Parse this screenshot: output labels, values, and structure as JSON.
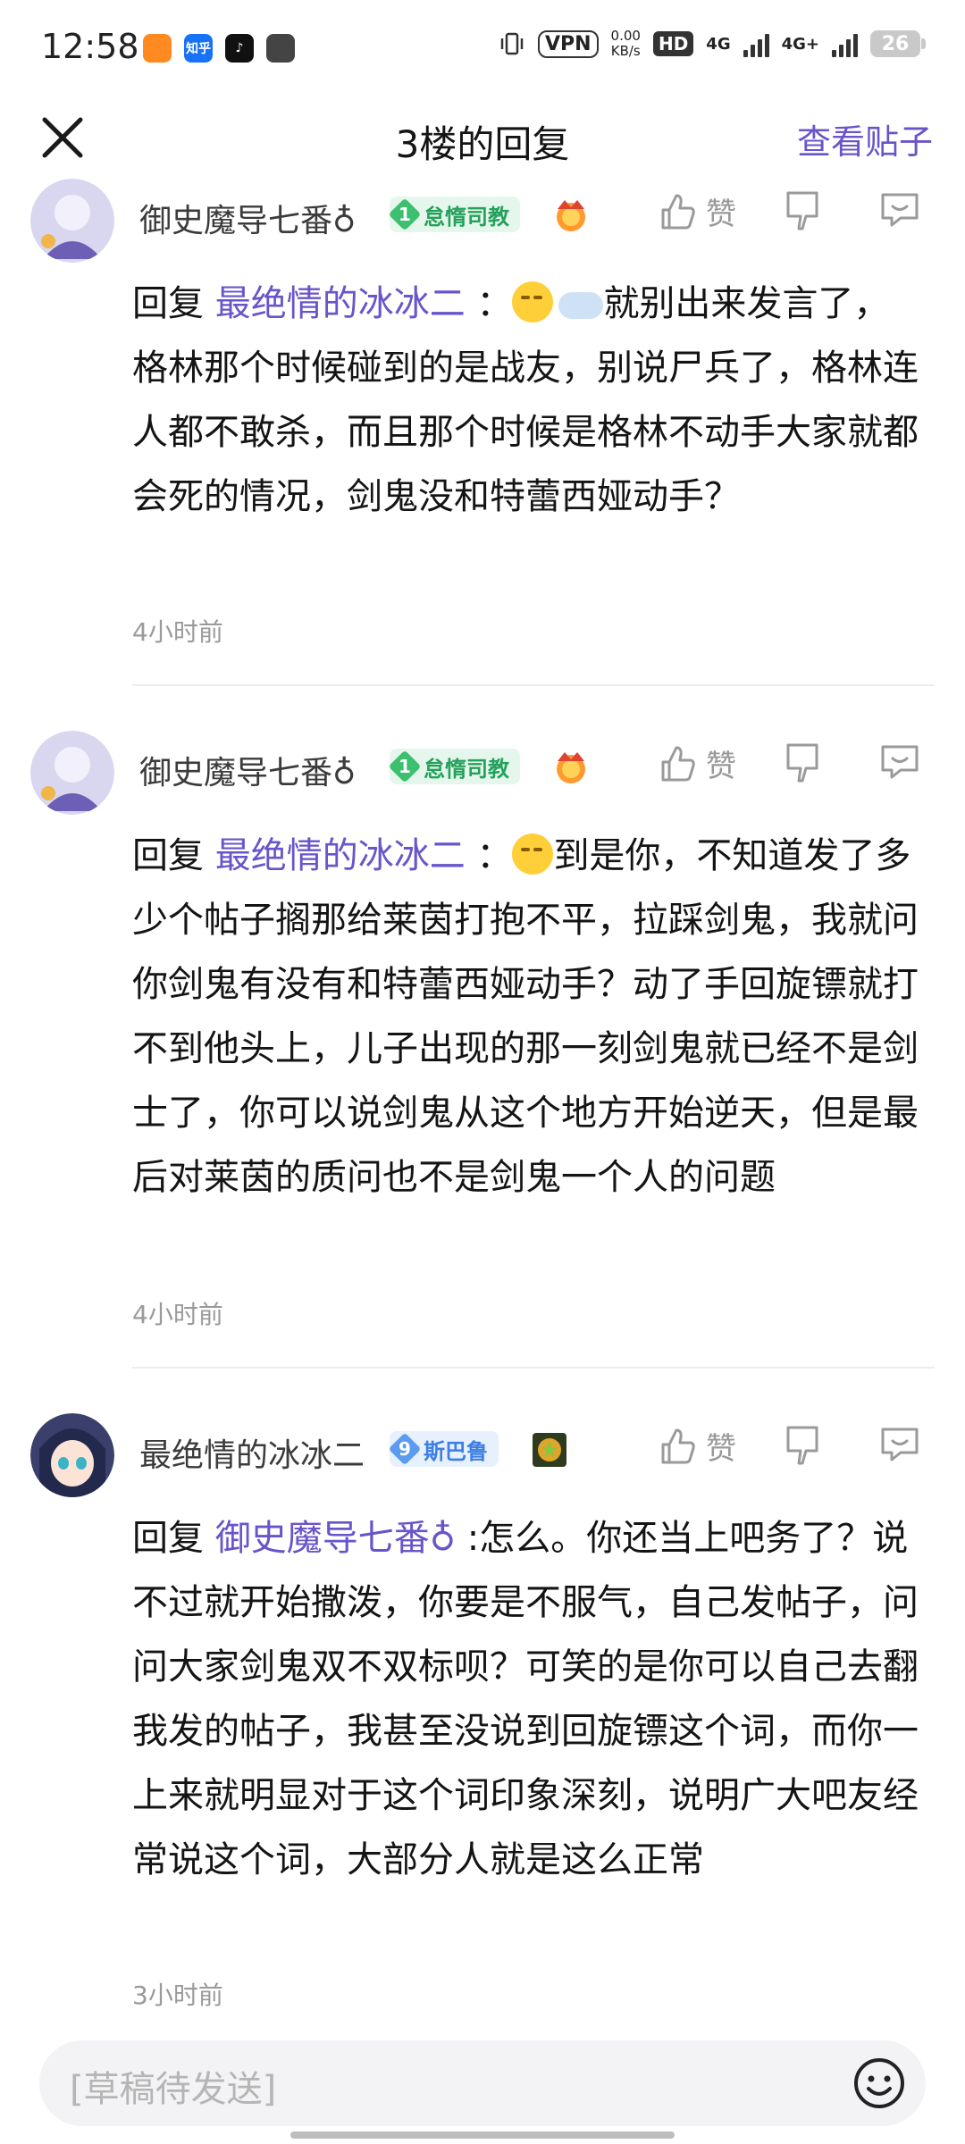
{
  "status_bar": {
    "time": "12:58",
    "apps": [
      {
        "name": "app-icon-1",
        "color": "#ff8a1f",
        "label": ""
      },
      {
        "name": "zhihu-icon",
        "color": "#1772f6",
        "label": "知乎"
      },
      {
        "name": "tiktok-icon",
        "color": "#111111",
        "label": "♪"
      },
      {
        "name": "cat-icon",
        "color": "#444444",
        "label": ""
      }
    ],
    "vpn": "VPN",
    "net_speed_value": "0.00",
    "net_speed_unit": "KB/s",
    "hd": "HD",
    "net1": "4G",
    "net2": "4G+",
    "battery": "26"
  },
  "header": {
    "title": "3楼的回复",
    "view_post": "查看贴子"
  },
  "replies": [
    {
      "username": "御史魔导七番♁",
      "badge_level": "1",
      "badge_text": "怠惰司教",
      "like_label": "赞",
      "reply_prefix": "回复 ",
      "mention": "最绝情的冰冰二",
      "colon": " ：",
      "text": "就别出来发言了，格林那个时候碰到的是战友，别说尸兵了，格林连人都不敢杀，而且那个时候是格林不动手大家就都会死的情况，剑鬼没和特蕾西娅动手？",
      "time": "4小时前"
    },
    {
      "username": "御史魔导七番♁",
      "badge_level": "1",
      "badge_text": "怠惰司教",
      "like_label": "赞",
      "reply_prefix": "回复 ",
      "mention": "最绝情的冰冰二",
      "colon": " ：",
      "text": "到是你，不知道发了多少个帖子搁那给莱茵打抱不平，拉踩剑鬼，我就问你剑鬼有没有和特蕾西娅动手？动了手回旋镖就打不到他头上，儿子出现的那一刻剑鬼就已经不是剑士了，你可以说剑鬼从这个地方开始逆天，但是最后对莱茵的质问也不是剑鬼一个人的问题",
      "time": "4小时前"
    },
    {
      "username": "最绝情的冰冰二",
      "badge_level": "9",
      "badge_text": "斯巴鲁",
      "like_label": "赞",
      "reply_prefix": "回复 ",
      "mention": "御史魔导七番♁",
      "colon": " :",
      "text": "怎么。你还当上吧务了？说不过就开始撒泼，你要是不服气，自己发帖子，问问大家剑鬼双不双标呗？可笑的是你可以自己去翻我发的帖子，我甚至没说到回旋镖这个词，而你一上来就明显对于这个词印象深刻，说明广大吧友经常说这个词，大部分人就是这么正常",
      "time": "3小时前"
    }
  ],
  "input": {
    "placeholder": "[草稿待发送]"
  },
  "colors": {
    "accent": "#6a54c9",
    "green_badge": "#3cc06f",
    "blue_badge": "#5b9bf0"
  }
}
